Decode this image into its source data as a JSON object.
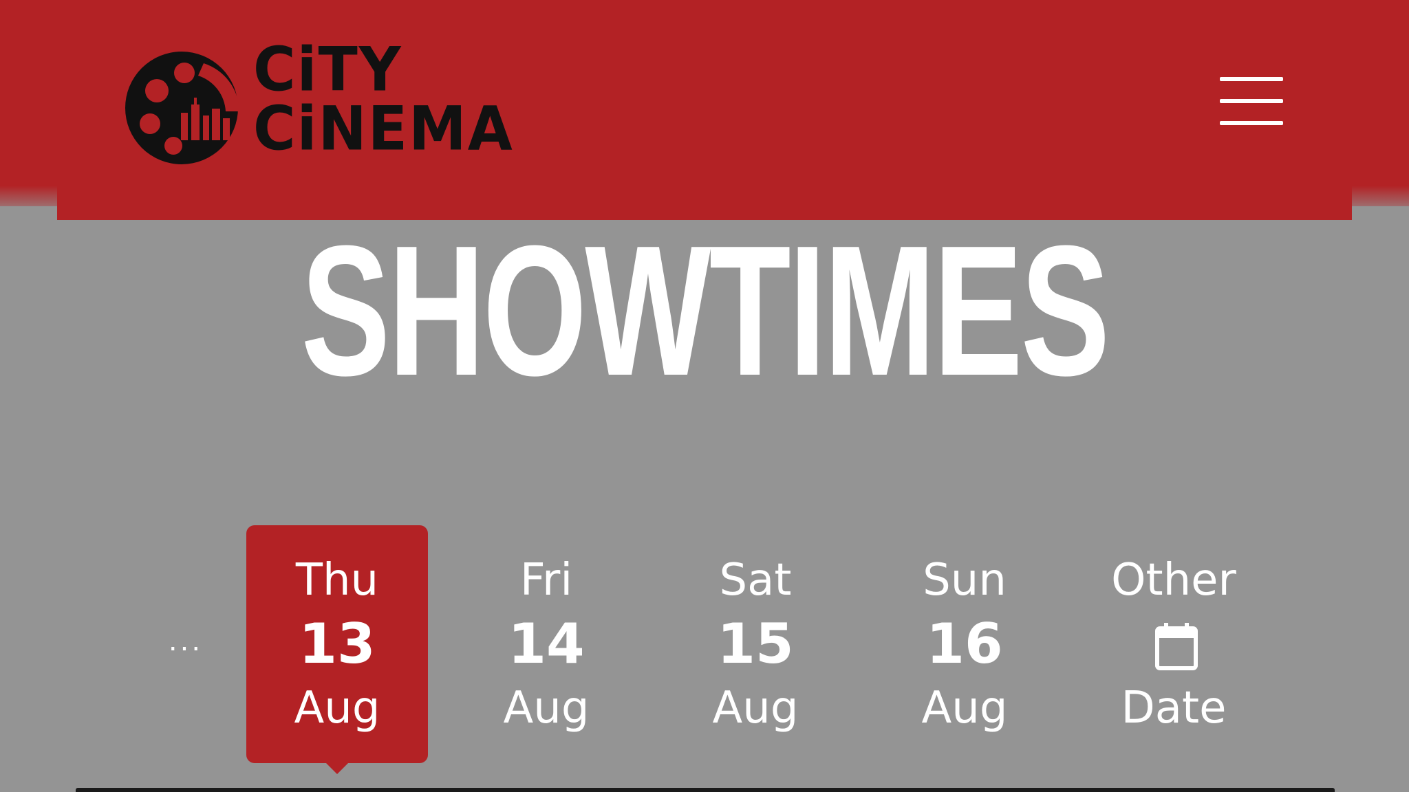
{
  "header": {
    "brand_line1": "CiTY",
    "brand_line2": "CiNEMA",
    "brand_color": "#b32225",
    "menu_icon": "hamburger-menu-icon"
  },
  "page": {
    "title": "SHOWTIMES",
    "background": "#949494"
  },
  "dates": {
    "more_label": "...",
    "items": [
      {
        "day": "Thu",
        "num": "13",
        "month": "Aug",
        "selected": true
      },
      {
        "day": "Fri",
        "num": "14",
        "month": "Aug",
        "selected": false
      },
      {
        "day": "Sat",
        "num": "15",
        "month": "Aug",
        "selected": false
      },
      {
        "day": "Sun",
        "num": "16",
        "month": "Aug",
        "selected": false
      }
    ],
    "other": {
      "label_top": "Other",
      "label_bottom": "Date",
      "icon": "calendar-icon"
    }
  }
}
